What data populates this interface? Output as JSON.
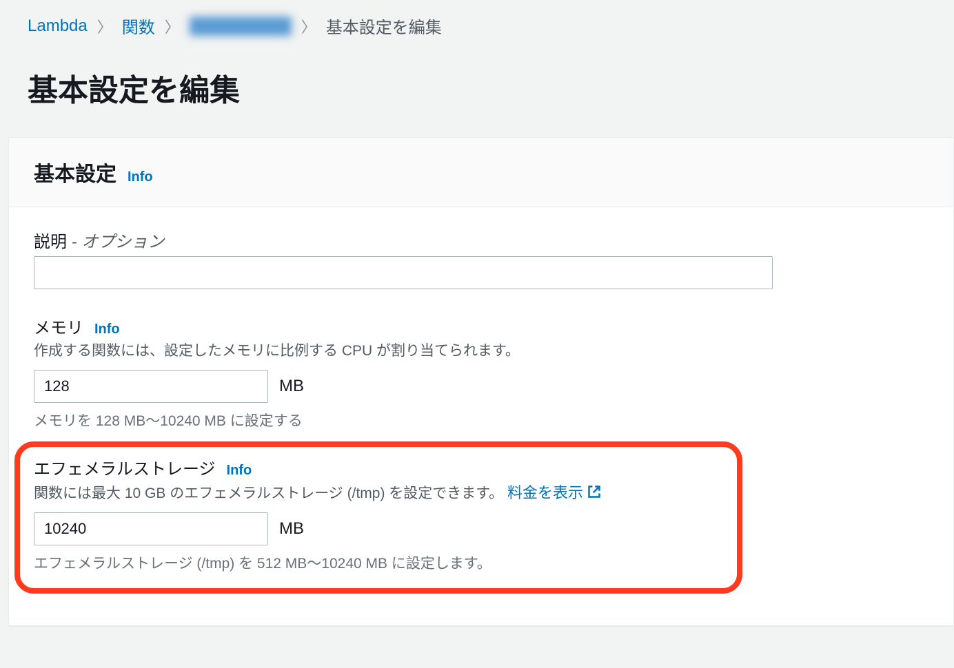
{
  "breadcrumb": {
    "lambda": "Lambda",
    "functions": "関数",
    "function_name": "████████",
    "current": "基本設定を編集"
  },
  "page_title": "基本設定を編集",
  "panel": {
    "title": "基本設定",
    "info": "Info"
  },
  "description": {
    "label": "説明",
    "optional": " - オプション",
    "value": ""
  },
  "memory": {
    "label": "メモリ",
    "info": "Info",
    "hint": "作成する関数には、設定したメモリに比例する CPU が割り当てられます。",
    "value": "128",
    "unit": "MB",
    "range": "メモリを 128 MB〜10240 MB に設定する"
  },
  "ephemeral": {
    "label": "エフェメラルストレージ",
    "info": "Info",
    "hint_prefix": "関数には最大 10 GB のエフェメラルストレージ (/tmp) を設定できます。",
    "pricing": "料金を表示",
    "value": "10240",
    "unit": "MB",
    "range": "エフェメラルストレージ (/tmp) を 512 MB〜10240 MB に設定します。"
  }
}
